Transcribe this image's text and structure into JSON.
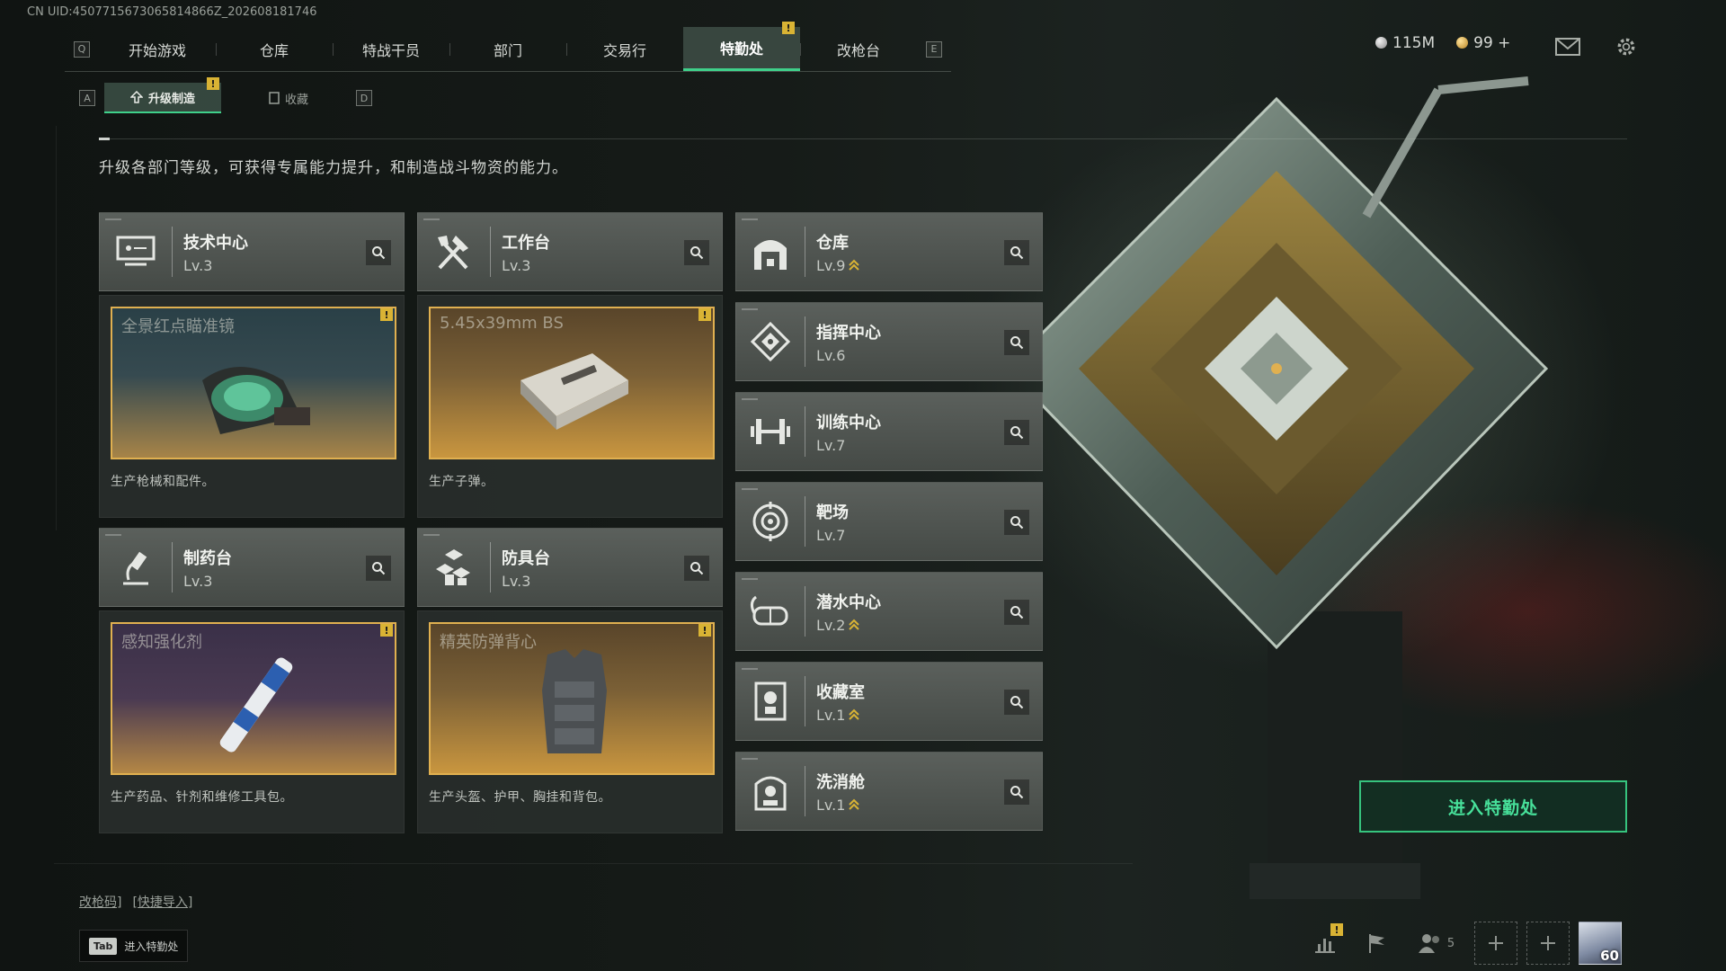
{
  "uid_text": "CN UID:4507715673065814866Z_202608181746",
  "nav": {
    "key_left": "Q",
    "key_right": "E",
    "tabs": [
      "开始游戏",
      "仓库",
      "特战干员",
      "部门",
      "交易行",
      "特勤处",
      "改枪台"
    ],
    "active_tab": "特勤处",
    "active_badge": "!"
  },
  "resources": {
    "silver": "115M",
    "gold": "99",
    "gold_add": "+"
  },
  "subnav": {
    "key_left": "A",
    "key_right": "D",
    "tabs": [
      {
        "label": "升级制造",
        "icon": "upgrade-icon",
        "active": true,
        "badge": "!"
      },
      {
        "label": "收藏",
        "icon": "collection-icon",
        "active": false
      }
    ]
  },
  "description": "升级各部门等级，可获得专属能力提升，和制造战斗物资的能力。",
  "production": [
    {
      "name": "技术中心",
      "level": "Lv.3",
      "icon": "tech-center-icon",
      "item": "全景红点瞄准镜",
      "item_desc": "生产枪械和配件。",
      "badge": "!"
    },
    {
      "name": "工作台",
      "level": "Lv.3",
      "icon": "workbench-icon",
      "item": "5.45x39mm BS",
      "item_desc": "生产子弹。",
      "badge": "!"
    },
    {
      "name": "制药台",
      "level": "Lv.3",
      "icon": "pharmacy-icon",
      "item": "感知强化剂",
      "item_desc": "生产药品、针剂和维修工具包。",
      "badge": "!"
    },
    {
      "name": "防具台",
      "level": "Lv.3",
      "icon": "armor-bench-icon",
      "item": "精英防弹背心",
      "item_desc": "生产头盔、护甲、胸挂和背包。",
      "badge": "!"
    }
  ],
  "departments": [
    {
      "name": "仓库",
      "level": "Lv.9",
      "icon": "warehouse-icon",
      "upgrade": true
    },
    {
      "name": "指挥中心",
      "level": "Lv.6",
      "icon": "command-center-icon",
      "upgrade": false
    },
    {
      "name": "训练中心",
      "level": "Lv.7",
      "icon": "training-center-icon",
      "upgrade": false
    },
    {
      "name": "靶场",
      "level": "Lv.7",
      "icon": "shooting-range-icon",
      "upgrade": false
    },
    {
      "name": "潜水中心",
      "level": "Lv.2",
      "icon": "diving-center-icon",
      "upgrade": true
    },
    {
      "name": "收藏室",
      "level": "Lv.1",
      "icon": "collection-room-icon",
      "upgrade": true
    },
    {
      "name": "洗消舱",
      "level": "Lv.1",
      "icon": "decontamination-icon",
      "upgrade": true
    }
  ],
  "enter_button": "进入特勤处",
  "bottom": {
    "gun_code": "改枪码]",
    "quick_import": "[快捷导入]",
    "tab_key": "Tab",
    "tab_hint": "进入特勤处",
    "friends_count": "5",
    "avatar_level": "60",
    "stats_badge": "!"
  },
  "colors": {
    "accent": "#3fd08a",
    "badge": "#d9b334",
    "item_border": "#e0b050"
  }
}
